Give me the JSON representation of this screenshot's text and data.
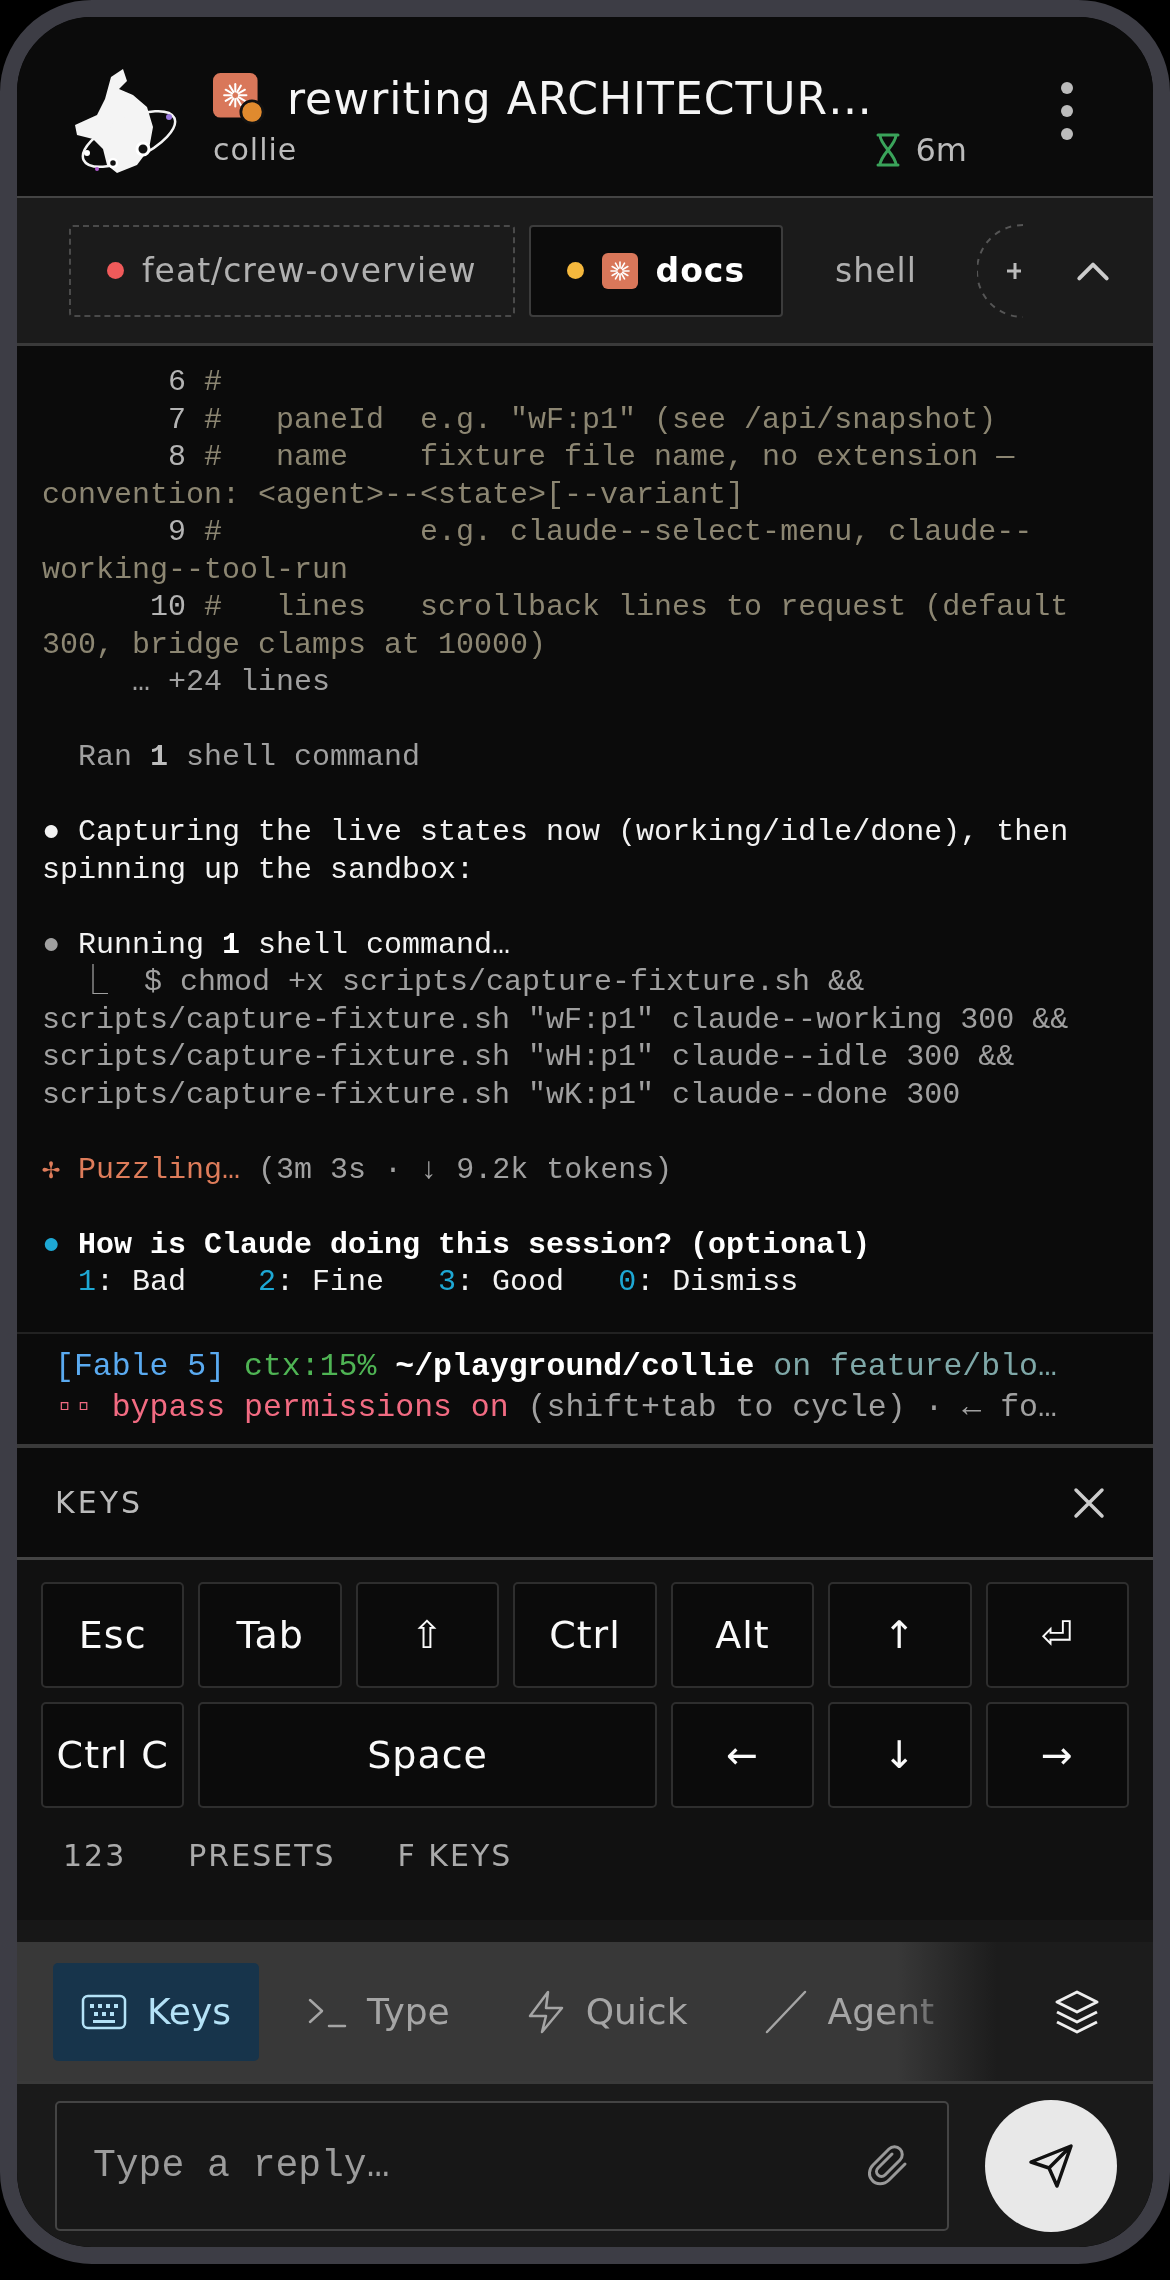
{
  "header": {
    "title": "rewriting ARCHITECTUR…",
    "subtitle": "collie",
    "elapsed": "6m"
  },
  "tabs": [
    {
      "label": "feat/crew-overview",
      "selected": false,
      "dashed": true,
      "color": "#f05a5a",
      "agent_icon": false
    },
    {
      "label": "docs",
      "selected": true,
      "dashed": false,
      "color": "#f5b83d",
      "agent_icon": true
    },
    {
      "label": "shell",
      "selected": false,
      "dashed": false,
      "agent_icon": false
    }
  ],
  "terminal": {
    "blocks": [
      {
        "lines": [
          {
            "segments": [
              {
                "text": "       6 ",
                "kind": "lineno"
              },
              {
                "text": "#",
                "kind": "comment"
              }
            ]
          },
          {
            "segments": [
              {
                "text": "       7 ",
                "kind": "lineno"
              },
              {
                "text": "#   paneId  e.g. \"wF:p1\" (see /api/snapshot)",
                "kind": "comment"
              }
            ]
          },
          {
            "segments": [
              {
                "text": "       8 ",
                "kind": "lineno"
              },
              {
                "text": "#   name    fixture file name, no extension —",
                "kind": "comment"
              }
            ]
          },
          {
            "segments": [
              {
                "text": "convention: <agent>--<state>[--variant]",
                "kind": "comment"
              }
            ]
          },
          {
            "segments": [
              {
                "text": "       9 ",
                "kind": "lineno"
              },
              {
                "text": "#           e.g. claude--select-menu, claude--",
                "kind": "comment"
              }
            ]
          },
          {
            "segments": [
              {
                "text": "working--tool-run",
                "kind": "comment"
              }
            ]
          },
          {
            "segments": [
              {
                "text": "      10 ",
                "kind": "lineno"
              },
              {
                "text": "#   lines   scrollback lines to request (default",
                "kind": "comment"
              }
            ]
          },
          {
            "segments": [
              {
                "text": "300, bridge clamps at 10000)",
                "kind": "comment"
              }
            ]
          },
          {
            "segments": [
              {
                "text": "     … +24 lines",
                "kind": "dim"
              }
            ]
          }
        ]
      },
      {
        "lines": [
          {
            "segments": [
              {
                "text": "  Ran ",
                "kind": "dim"
              },
              {
                "text": "1",
                "kind": "dimbold"
              },
              {
                "text": " shell command",
                "kind": "dim"
              }
            ]
          }
        ]
      },
      {
        "lines": [
          {
            "segments": [
              {
                "text": "● Capturing the live states now (working/idle/done), then",
                "kind": "white"
              }
            ]
          },
          {
            "segments": [
              {
                "text": "spinning up the sandbox:",
                "kind": "white"
              }
            ]
          }
        ]
      },
      {
        "lines": [
          {
            "segments": [
              {
                "text": "● ",
                "kind": "dim"
              },
              {
                "text": "Running ",
                "kind": "white"
              },
              {
                "text": "1",
                "kind": "bold"
              },
              {
                "text": " shell command…",
                "kind": "white"
              }
            ]
          },
          {
            "segments": [
              {
                "text": "  ⎿  $ chmod +x scripts/capture-fixture.sh &&",
                "kind": "dim"
              }
            ]
          },
          {
            "segments": [
              {
                "text": "scripts/capture-fixture.sh \"wF:p1\" claude--working 300 &&",
                "kind": "dim"
              }
            ]
          },
          {
            "segments": [
              {
                "text": "scripts/capture-fixture.sh \"wH:p1\" claude--idle 300 &&",
                "kind": "dim"
              }
            ]
          },
          {
            "segments": [
              {
                "text": "scripts/capture-fixture.sh \"wK:p1\" claude--done 300",
                "kind": "dim"
              }
            ]
          }
        ]
      },
      {
        "lines": [
          {
            "segments": [
              {
                "text": "✢ Puzzling…",
                "kind": "orange"
              },
              {
                "text": " (3m 3s · ↓ 9.2k tokens)",
                "kind": "dim"
              }
            ]
          }
        ]
      },
      {
        "lines": [
          {
            "segments": [
              {
                "text": "● ",
                "kind": "cyan"
              },
              {
                "text": "How is Claude doing this session? (optional)",
                "kind": "bold"
              }
            ]
          },
          {
            "segments": [
              {
                "text": "  1",
                "kind": "cyan"
              },
              {
                "text": ": Bad    ",
                "kind": "white"
              },
              {
                "text": "2",
                "kind": "cyan"
              },
              {
                "text": ": Fine   ",
                "kind": "white"
              },
              {
                "text": "3",
                "kind": "cyan"
              },
              {
                "text": ": Good   ",
                "kind": "white"
              },
              {
                "text": "0",
                "kind": "cyan"
              },
              {
                "text": ": Dismiss",
                "kind": "white"
              }
            ]
          }
        ]
      }
    ]
  },
  "status_line": [
    {
      "segments": [
        {
          "text": "[Fable 5]",
          "kind": "blue"
        },
        {
          "text": " ctx:15%",
          "kind": "green"
        },
        {
          "text": " ~/playground/collie",
          "kind": "bold"
        },
        {
          "text": " on feature/blo…",
          "kind": "teal"
        }
      ]
    },
    {
      "segments": [
        {
          "text": "▫▫ bypass permissions on",
          "kind": "pink"
        },
        {
          "text": " (shift+tab to cycle) · ← fo…",
          "kind": "dim"
        }
      ]
    }
  ],
  "keys_panel": {
    "title": "KEYS",
    "keys": [
      {
        "label": "Esc",
        "wide": false
      },
      {
        "label": "Tab",
        "wide": false
      },
      {
        "label": "⇧",
        "wide": false
      },
      {
        "label": "Ctrl",
        "wide": false
      },
      {
        "label": "Alt",
        "wide": false
      },
      {
        "label": "↑",
        "wide": false
      },
      {
        "label": "⏎",
        "wide": false
      },
      {
        "label": "Ctrl C",
        "wide": false
      },
      {
        "label": "Space",
        "wide": true
      },
      {
        "label": "←",
        "wide": false
      },
      {
        "label": "↓",
        "wide": false
      },
      {
        "label": "→",
        "wide": false
      }
    ],
    "sections": [
      "123",
      "PRESETS",
      "F KEYS"
    ]
  },
  "mode_bar": [
    {
      "label": "Keys",
      "kind": "keyboard",
      "selected": true
    },
    {
      "label": "Type",
      "kind": "terminal",
      "selected": false
    },
    {
      "label": "Quick",
      "kind": "bolt",
      "selected": false
    },
    {
      "label": "Agent",
      "kind": "slash",
      "selected": false
    }
  ],
  "reply": {
    "placeholder": "Type a reply…"
  }
}
